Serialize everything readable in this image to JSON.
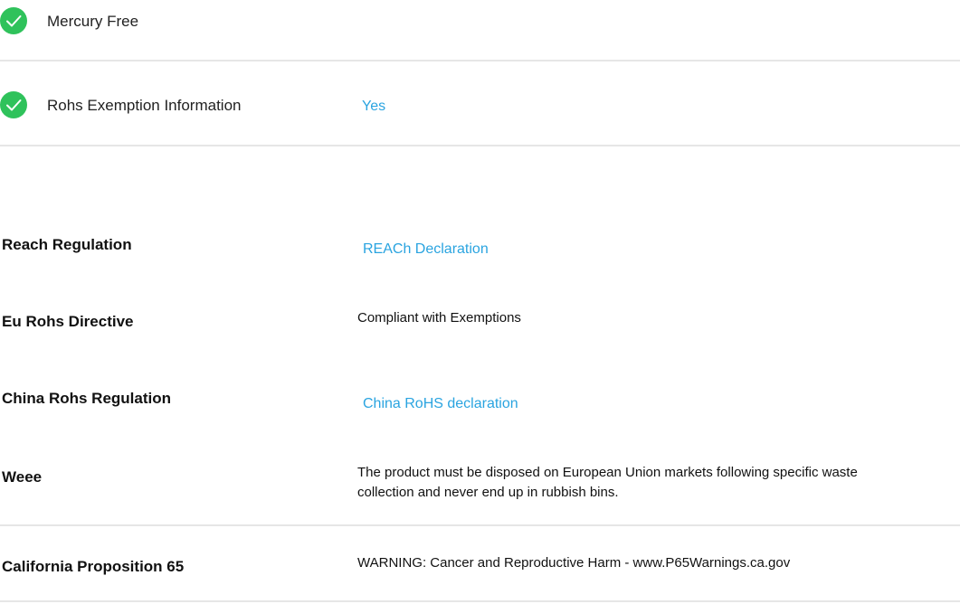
{
  "checks": [
    {
      "label": "Mercury Free",
      "value": ""
    },
    {
      "label": "Rohs Exemption Information",
      "value": "Yes"
    }
  ],
  "regulations": [
    {
      "label": "Reach Regulation",
      "link": "REACh Declaration"
    },
    {
      "label": "Eu Rohs Directive",
      "text": "Compliant with Exemptions"
    },
    {
      "label": "China Rohs Regulation",
      "link": "China RoHS declaration"
    },
    {
      "label": "Weee",
      "text_line1": "The product must be disposed on European Union markets following specific waste",
      "text_line2": "collection and never end up in rubbish bins."
    },
    {
      "label": "California Proposition 65",
      "text": "WARNING: Cancer and Reproductive Harm - www.P65Warnings.ca.gov"
    }
  ],
  "colors": {
    "check_green": "#2fc25b",
    "link_blue": "#2aa4e0",
    "divider": "#e6e6e6"
  }
}
